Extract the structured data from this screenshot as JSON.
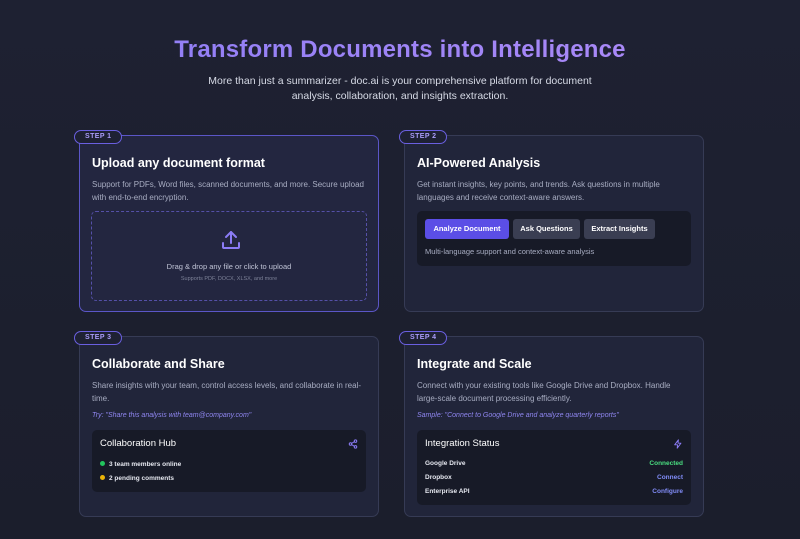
{
  "hero": {
    "title": "Transform Documents into Intelligence",
    "subtitle": "More than just a summarizer - doc.ai is your comprehensive platform for document analysis, collaboration, and insights extraction."
  },
  "cards": [
    {
      "step": "STEP 1",
      "title": "Upload any document format",
      "desc": "Support for PDFs, Word files, scanned documents, and more. Secure upload with end-to-end encryption.",
      "upload_main": "Drag & drop any file or click to upload",
      "upload_note": "Supports PDF, DOCX, XLSX, and more",
      "icon": "upload-icon"
    },
    {
      "step": "STEP 2",
      "title": "AI-Powered Analysis",
      "desc": "Get instant insights, key points, and trends. Ask questions in multiple languages and receive context-aware answers.",
      "buttons": [
        "Analyze Document",
        "Ask Questions",
        "Extract Insights"
      ],
      "note": "Multi-language support and context-aware analysis"
    },
    {
      "step": "STEP 3",
      "title": "Collaborate and Share",
      "desc": "Share insights with your team, control access levels, and collaborate in real-time.",
      "try": "Try: \"Share this analysis with team@company.com\"",
      "hub_title": "Collaboration Hub",
      "hub_icon": "share-icon",
      "statuses": [
        {
          "text": "3 team members online",
          "color": "#22c55e"
        },
        {
          "text": "2 pending comments",
          "color": "#eab308"
        }
      ]
    },
    {
      "step": "STEP 4",
      "title": "Integrate and Scale",
      "desc": "Connect with your existing tools like Google Drive and Dropbox. Handle large-scale document processing efficiently.",
      "sample": "Sample: \"Connect to Google Drive and analyze quarterly reports\"",
      "panel_title": "Integration Status",
      "panel_icon": "lightning-icon",
      "integrations": [
        {
          "name": "Google Drive",
          "status": "Connected",
          "color": "#4ade80"
        },
        {
          "name": "Dropbox",
          "status": "Connect",
          "color": "#818cf8"
        },
        {
          "name": "Enterprise API",
          "status": "Configure",
          "color": "#818cf8"
        }
      ]
    }
  ],
  "colors": {
    "accent": "#8b7cf6",
    "primary_button": "#5b4ee6",
    "background": "#1c1f2e"
  }
}
